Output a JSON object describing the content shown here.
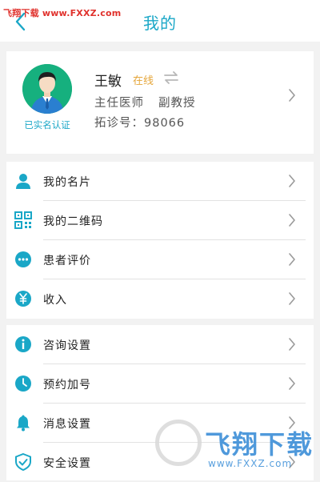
{
  "watermark_top": "飞翔下载 www.FXXZ.com",
  "header": {
    "title": "我的"
  },
  "profile": {
    "name": "王敏",
    "status": "在线",
    "title": "主任医师",
    "rank": "副教授",
    "tuozhen_no": "拓诊号：98066",
    "verified": "已实名认证"
  },
  "menu1": [
    {
      "label": "我的名片",
      "icon": "person-icon"
    },
    {
      "label": "我的二维码",
      "icon": "qrcode-icon"
    },
    {
      "label": "患者评价",
      "icon": "comment-icon"
    },
    {
      "label": "收入",
      "icon": "yuan-icon"
    }
  ],
  "menu2": [
    {
      "label": "咨询设置",
      "icon": "info-icon"
    },
    {
      "label": "预约加号",
      "icon": "clock-icon"
    },
    {
      "label": "消息设置",
      "icon": "bell-icon"
    },
    {
      "label": "安全设置",
      "icon": "shield-icon"
    }
  ],
  "watermark_br": {
    "brand": "飞翔下载",
    "url": "www.FXXZ.com"
  },
  "colors": {
    "accent": "#1aa7c7",
    "online": "#e5a63b",
    "avatar_bg": "#16b07e"
  }
}
